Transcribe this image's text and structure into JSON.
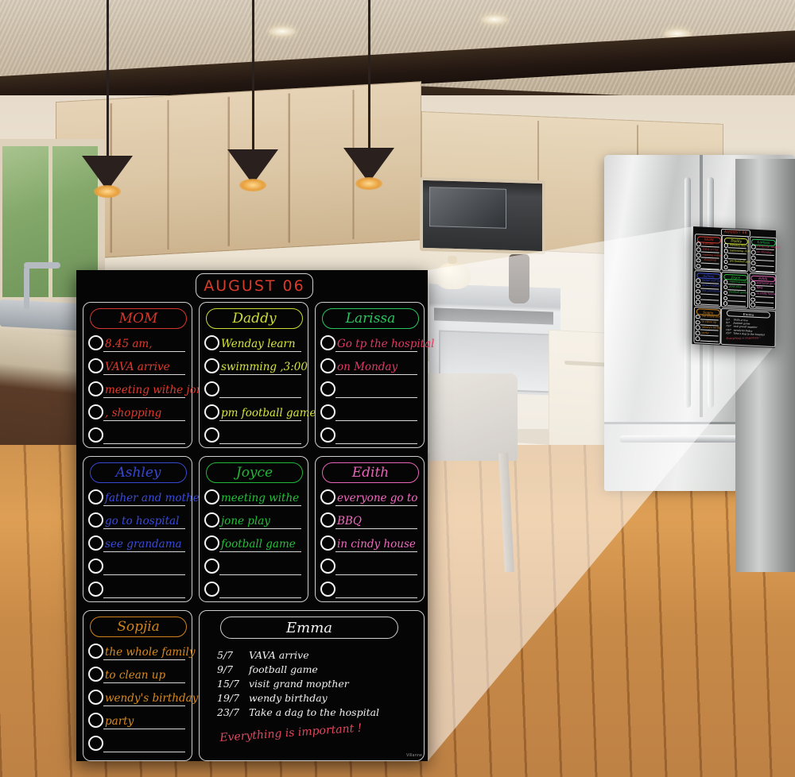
{
  "scene": {
    "description": "Magnetic dry-erase family planner board shown on a kitchen refrigerator with a zoom callout",
    "watermark": "Villanne"
  },
  "board": {
    "title": "AUGUST 06",
    "title_color": "#d93b2b",
    "columns": [
      {
        "name": "MOM",
        "color": "#e03a2e",
        "entries": [
          "8.45 am,",
          "VAVA arrive",
          "meeting withe jone",
          ",  shopping",
          ""
        ]
      },
      {
        "name": "Daddy",
        "color": "#d8e63a",
        "entries": [
          "Wenday learn",
          "swimming ,3:00",
          "",
          "pm  football game",
          ""
        ]
      },
      {
        "name": "Larissa",
        "color": "#2ecf63",
        "entries": [
          "Go tp the hospital",
          "on Monday",
          "",
          "",
          ""
        ],
        "entry_color": "#e03a64"
      },
      {
        "name": "Ashley",
        "color": "#3a4bdb",
        "entries": [
          "father and mother",
          "go to hospital",
          "see grandama",
          "",
          ""
        ]
      },
      {
        "name": "Joyce",
        "color": "#23c03a",
        "entries": [
          "meeting withe",
          "jone play",
          "football game",
          "",
          ""
        ]
      },
      {
        "name": "Edith",
        "color": "#f06ac0",
        "entries": [
          "everyone go to",
          "BBQ",
          "in cindy  house",
          "",
          ""
        ]
      },
      {
        "name": "Sopjia",
        "color": "#d98a1e",
        "entries": [
          "the whole family",
          "to clean up",
          "wendy's birthday",
          "party",
          ""
        ]
      }
    ],
    "notes_panel": {
      "name": "Emma",
      "name_color": "#f2f2f2",
      "lines": [
        {
          "date": "5/7",
          "text": "VAVA  arrive"
        },
        {
          "date": "9/7",
          "text": "football  game"
        },
        {
          "date": "15/7",
          "text": "visit grand mopther"
        },
        {
          "date": "19/7",
          "text": "wendy birthday"
        },
        {
          "date": "23/7",
          "text": "Take a dag to  the hospital"
        }
      ],
      "footer": "Everything is important !",
      "footer_color": "#e1485f"
    }
  }
}
